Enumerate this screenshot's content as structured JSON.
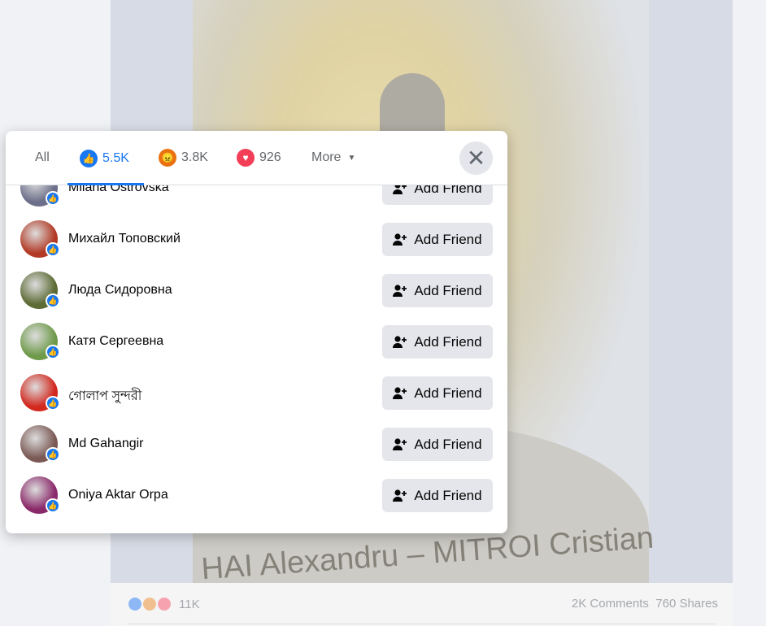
{
  "post": {
    "reaction_total": "11K",
    "comments": "2K Comments",
    "shares": "760 Shares",
    "photo_text": "HAI Alexandru – MITROI Cristian"
  },
  "dialog": {
    "tabs": [
      {
        "label": "All"
      },
      {
        "label": "5.5K",
        "icon": "like-icon",
        "color": "#1877f2"
      },
      {
        "label": "3.8K",
        "icon": "angry-icon",
        "color": "#e9710f"
      },
      {
        "label": "926",
        "icon": "love-icon",
        "color": "#f33e58"
      },
      {
        "label": "More",
        "icon": "caret-down-icon"
      }
    ],
    "active_tab": 1,
    "close": "close-icon",
    "button_label": "Add Friend",
    "people": [
      {
        "name": "Milana Ostrovska",
        "avatar": "#6c6f8a"
      },
      {
        "name": "Михайл Топовский",
        "avatar": "#b23a25"
      },
      {
        "name": "Люда Сидоровна",
        "avatar": "#5d6b35"
      },
      {
        "name": "Катя Сергеевна",
        "avatar": "#6f9a4a"
      },
      {
        "name": "গোলাপ সুন্দরী",
        "avatar": "#d2281e"
      },
      {
        "name": "Md Gahangir",
        "avatar": "#7b5a55"
      },
      {
        "name": "Oniya Aktar Orpa",
        "avatar": "#8a2a6a"
      }
    ]
  }
}
